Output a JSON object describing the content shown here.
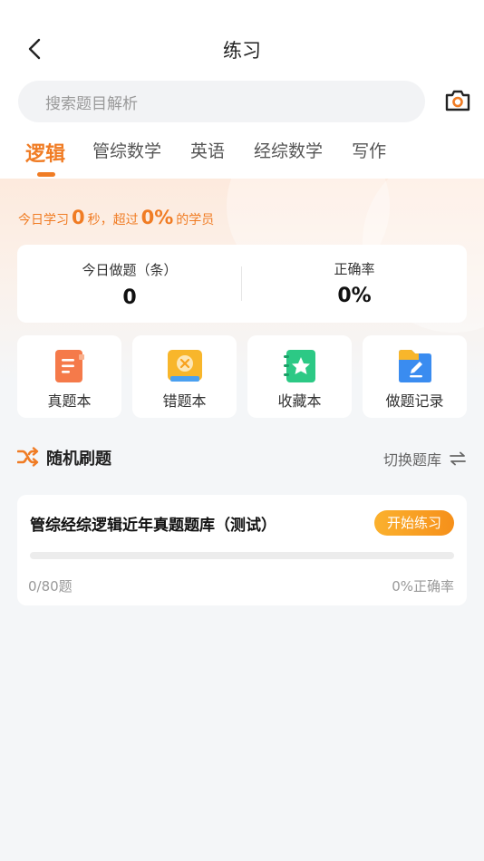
{
  "header": {
    "title": "练习"
  },
  "search": {
    "placeholder": "搜索题目解析"
  },
  "tabs": [
    {
      "label": "逻辑",
      "active": true
    },
    {
      "label": "管综数学"
    },
    {
      "label": "英语"
    },
    {
      "label": "经综数学"
    },
    {
      "label": "写作"
    }
  ],
  "today": {
    "prefix": "今日学习",
    "seconds": "0",
    "sec_unit": "秒，超过",
    "percent": "0%",
    "suffix": "的学员"
  },
  "stats": {
    "done_label": "今日做题（条）",
    "done_value": "0",
    "accuracy_label": "正确率",
    "accuracy_value": "0%"
  },
  "quick": [
    {
      "label": "真题本",
      "icon": "notebook-icon",
      "color": "#f57a4a"
    },
    {
      "label": "错题本",
      "icon": "wrong-book-icon",
      "color": "#f8b62b"
    },
    {
      "label": "收藏本",
      "icon": "star-book-icon",
      "color": "#2cc985"
    },
    {
      "label": "做题记录",
      "icon": "folder-record-icon",
      "color": "#3a8cf0"
    }
  ],
  "section": {
    "title": "随机刷题",
    "switch_label": "切换题库"
  },
  "bank": {
    "title": "管综经综逻辑近年真题题库（测试）",
    "start_label": "开始练习",
    "count": "0/80题",
    "accuracy": "0%正确率",
    "progress": 0
  },
  "colors": {
    "accent": "#f07c24",
    "button": "#f6901a"
  }
}
